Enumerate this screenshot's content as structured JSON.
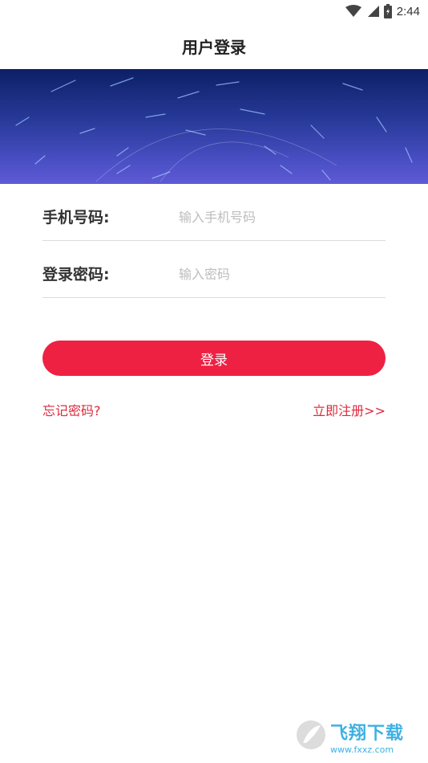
{
  "status_bar": {
    "time": "2:44",
    "icons": [
      "wifi-icon",
      "signal-icon",
      "battery-icon"
    ]
  },
  "header": {
    "title": "用户登录"
  },
  "banner": {
    "description_colors": [
      "#0c1f66",
      "#5f5ad4"
    ]
  },
  "form": {
    "phone": {
      "label": "手机号码:",
      "placeholder": "输入手机号码",
      "value": ""
    },
    "password": {
      "label": "登录密码:",
      "placeholder": "输入密码",
      "value": ""
    }
  },
  "actions": {
    "login_label": "登录",
    "forgot_label": "忘记密码?",
    "register_label": "立即注册>>"
  },
  "watermark": {
    "main": "飞翔下载",
    "sub": "www.fxxz.com"
  },
  "colors": {
    "accent": "#ee2143",
    "link": "#dd2a3e"
  }
}
